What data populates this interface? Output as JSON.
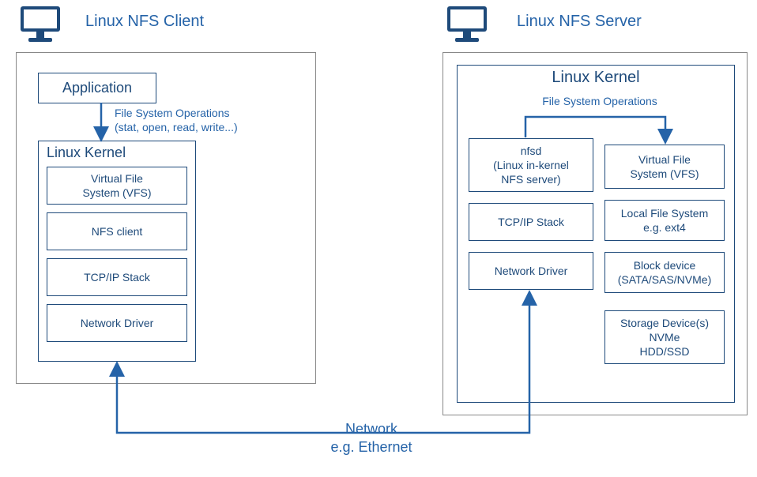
{
  "client": {
    "title": "Linux NFS Client",
    "application": "Application",
    "fsops_label": "File System Operations\n(stat, open, read, write...)",
    "kernel_title": "Linux Kernel",
    "boxes": [
      "Virtual File\nSystem (VFS)",
      "NFS client",
      "TCP/IP Stack",
      "Network Driver"
    ]
  },
  "server": {
    "title": "Linux NFS Server",
    "kernel_title": "Linux Kernel",
    "fsops_label": "File System Operations",
    "left_boxes": [
      "nfsd\n(Linux in-kernel\nNFS server)",
      "TCP/IP Stack",
      "Network Driver"
    ],
    "right_boxes": [
      "Virtual File\nSystem (VFS)",
      "Local File System\ne.g. ext4",
      "Block device\n(SATA/SAS/NVMe)",
      "Storage Device(s)\nNVMe\nHDD/SSD"
    ]
  },
  "network_label": "Network\ne.g. Ethernet"
}
